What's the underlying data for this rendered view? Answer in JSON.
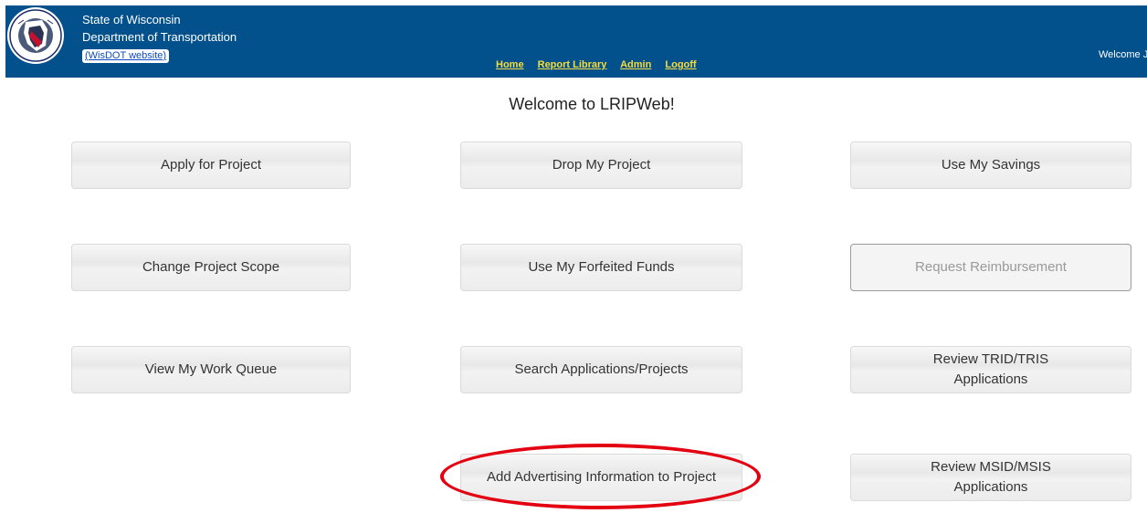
{
  "header": {
    "agency_line1": "State of Wisconsin",
    "agency_line2": "Department of Transportation",
    "website_link": "(WisDOT website)",
    "seal_icon": "wisdot-seal-icon",
    "nav": [
      "Home",
      "Report Library",
      "Admin",
      "Logoff"
    ],
    "welcome_user": "Welcome J"
  },
  "main": {
    "title": "Welcome to LRIPWeb!",
    "tiles": [
      {
        "label": "Apply for Project"
      },
      {
        "label": "Drop My Project"
      },
      {
        "label": "Use My Savings"
      },
      {
        "label": "Change Project Scope"
      },
      {
        "label": "Use My Forfeited Funds"
      },
      {
        "label": "Request Reimbursement",
        "state": "disabled"
      },
      {
        "label": "View My Work Queue"
      },
      {
        "label": "Search Applications/Projects"
      },
      {
        "label_line1": "Review TRID/TRIS",
        "label_line2": "Applications"
      },
      {
        "label": "Add Advertising Information to Project",
        "annotation": "red ellipse highlight"
      },
      {
        "label_line1": "Review MSID/MSIS",
        "label_line2": "Applications"
      }
    ]
  },
  "colors": {
    "header_bg": "#03518c",
    "nav_link": "#f7dc3b",
    "highlight": "#e30010"
  }
}
